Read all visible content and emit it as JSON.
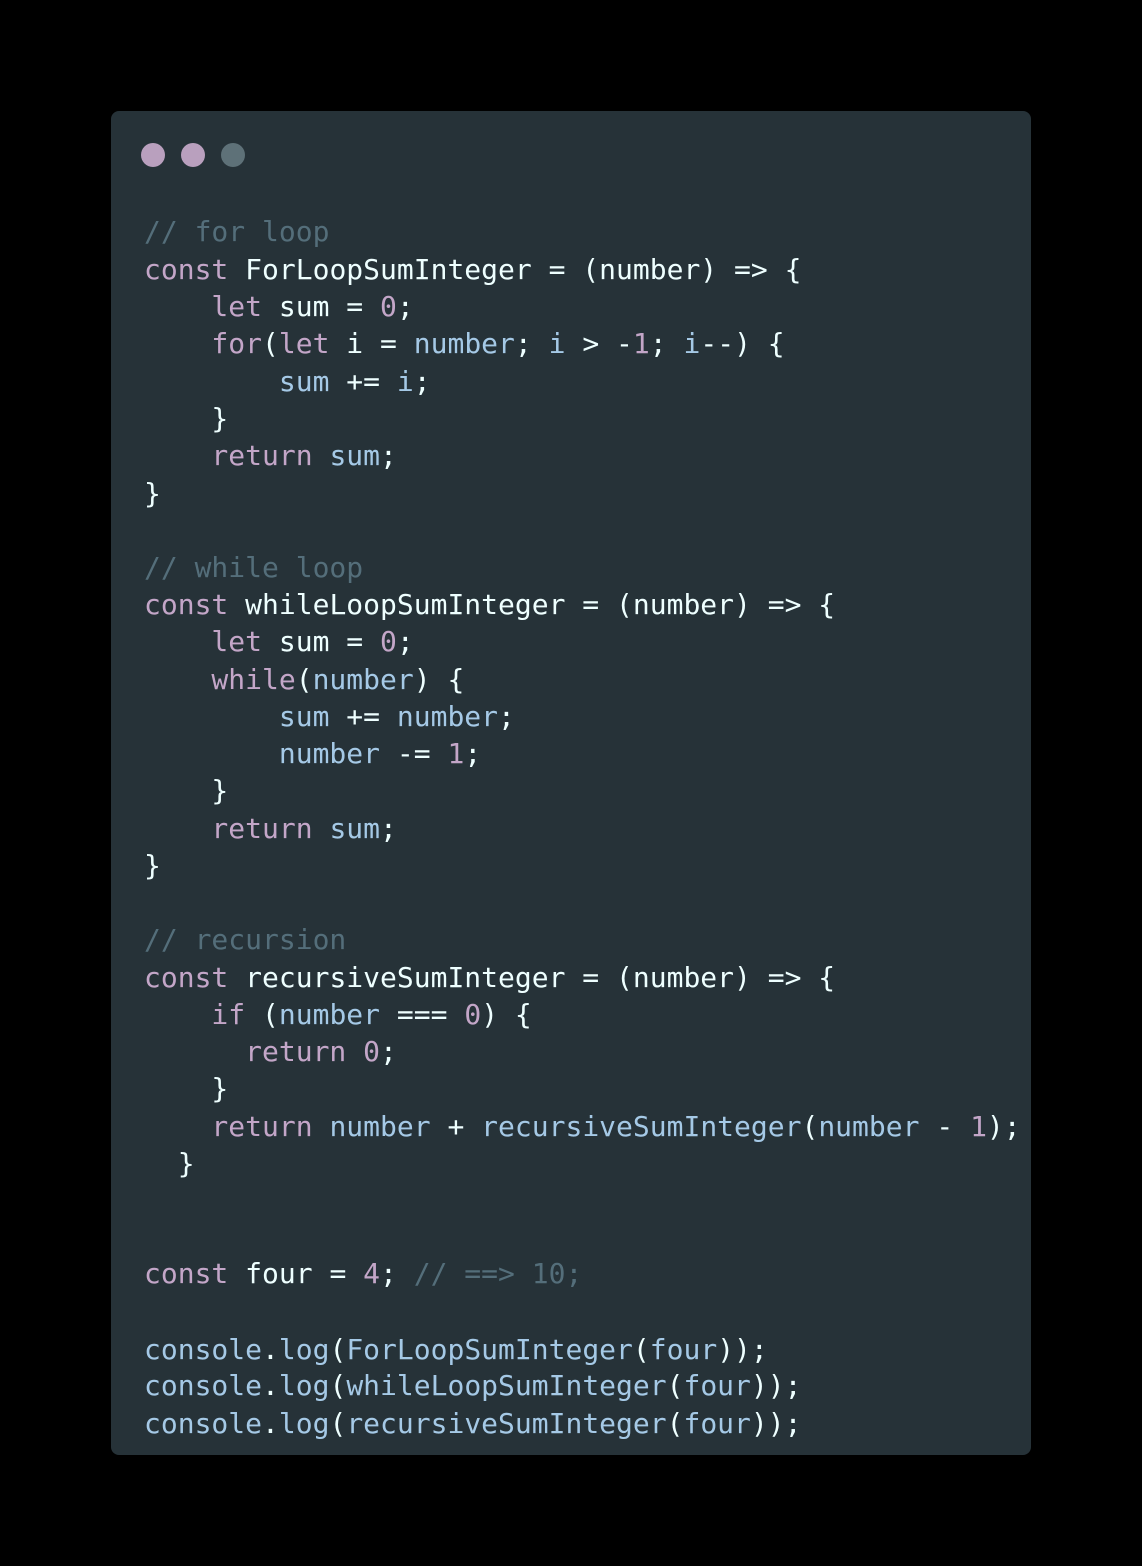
{
  "window": {
    "controls": [
      {
        "name": "close",
        "color": "#b9a0be"
      },
      {
        "name": "minimize",
        "color": "#b9a0be"
      },
      {
        "name": "maximize",
        "color": "#5e7178"
      }
    ]
  },
  "colors": {
    "background": "#000000",
    "editor_background": "#263238",
    "comment": "#546e7a",
    "keyword": "#c3a6c8",
    "identifier": "#a5c9e6",
    "text": "#eeffff"
  },
  "code": {
    "language": "javascript",
    "lines": [
      [
        {
          "t": "// for loop",
          "c": "comment"
        }
      ],
      [
        {
          "t": "const",
          "c": "keyword"
        },
        {
          "t": " ForLoopSumInteger = (number) => {",
          "c": "plain"
        }
      ],
      [
        {
          "t": "    let",
          "c": "keyword"
        },
        {
          "t": " sum = ",
          "c": "plain"
        },
        {
          "t": "0",
          "c": "num"
        },
        {
          "t": ";",
          "c": "plain"
        }
      ],
      [
        {
          "t": "    for",
          "c": "keyword"
        },
        {
          "t": "(",
          "c": "plain"
        },
        {
          "t": "let",
          "c": "keyword"
        },
        {
          "t": " i = ",
          "c": "plain"
        },
        {
          "t": "number",
          "c": "var"
        },
        {
          "t": "; ",
          "c": "plain"
        },
        {
          "t": "i",
          "c": "var"
        },
        {
          "t": " > -",
          "c": "plain"
        },
        {
          "t": "1",
          "c": "num"
        },
        {
          "t": "; ",
          "c": "plain"
        },
        {
          "t": "i",
          "c": "var"
        },
        {
          "t": "--) {",
          "c": "plain"
        }
      ],
      [
        {
          "t": "        sum",
          "c": "var"
        },
        {
          "t": " += ",
          "c": "plain"
        },
        {
          "t": "i",
          "c": "var"
        },
        {
          "t": ";",
          "c": "plain"
        }
      ],
      [
        {
          "t": "    }",
          "c": "plain"
        }
      ],
      [
        {
          "t": "    return",
          "c": "keyword"
        },
        {
          "t": " ",
          "c": "plain"
        },
        {
          "t": "sum",
          "c": "var"
        },
        {
          "t": ";",
          "c": "plain"
        }
      ],
      [
        {
          "t": "}",
          "c": "plain"
        }
      ],
      [
        {
          "t": "",
          "c": "plain"
        }
      ],
      [
        {
          "t": "// while loop",
          "c": "comment"
        }
      ],
      [
        {
          "t": "const",
          "c": "keyword"
        },
        {
          "t": " whileLoopSumInteger = (number) => {",
          "c": "plain"
        }
      ],
      [
        {
          "t": "    let",
          "c": "keyword"
        },
        {
          "t": " sum = ",
          "c": "plain"
        },
        {
          "t": "0",
          "c": "num"
        },
        {
          "t": ";",
          "c": "plain"
        }
      ],
      [
        {
          "t": "    while",
          "c": "keyword"
        },
        {
          "t": "(",
          "c": "plain"
        },
        {
          "t": "number",
          "c": "var"
        },
        {
          "t": ") {",
          "c": "plain"
        }
      ],
      [
        {
          "t": "        sum",
          "c": "var"
        },
        {
          "t": " += ",
          "c": "plain"
        },
        {
          "t": "number",
          "c": "var"
        },
        {
          "t": ";",
          "c": "plain"
        }
      ],
      [
        {
          "t": "        number",
          "c": "var"
        },
        {
          "t": " -= ",
          "c": "plain"
        },
        {
          "t": "1",
          "c": "num"
        },
        {
          "t": ";",
          "c": "plain"
        }
      ],
      [
        {
          "t": "    }",
          "c": "plain"
        }
      ],
      [
        {
          "t": "    return",
          "c": "keyword"
        },
        {
          "t": " ",
          "c": "plain"
        },
        {
          "t": "sum",
          "c": "var"
        },
        {
          "t": ";",
          "c": "plain"
        }
      ],
      [
        {
          "t": "}",
          "c": "plain"
        }
      ],
      [
        {
          "t": "",
          "c": "plain"
        }
      ],
      [
        {
          "t": "// recursion",
          "c": "comment"
        }
      ],
      [
        {
          "t": "const",
          "c": "keyword"
        },
        {
          "t": " recursiveSumInteger = (number) => {",
          "c": "plain"
        }
      ],
      [
        {
          "t": "    if",
          "c": "keyword"
        },
        {
          "t": " (",
          "c": "plain"
        },
        {
          "t": "number",
          "c": "var"
        },
        {
          "t": " === ",
          "c": "plain"
        },
        {
          "t": "0",
          "c": "num"
        },
        {
          "t": ") {",
          "c": "plain"
        }
      ],
      [
        {
          "t": "      return",
          "c": "keyword"
        },
        {
          "t": " ",
          "c": "plain"
        },
        {
          "t": "0",
          "c": "num"
        },
        {
          "t": ";",
          "c": "plain"
        }
      ],
      [
        {
          "t": "    }",
          "c": "plain"
        }
      ],
      [
        {
          "t": "    return",
          "c": "keyword"
        },
        {
          "t": " ",
          "c": "plain"
        },
        {
          "t": "number",
          "c": "var"
        },
        {
          "t": " + ",
          "c": "plain"
        },
        {
          "t": "recursiveSumInteger",
          "c": "var"
        },
        {
          "t": "(",
          "c": "plain"
        },
        {
          "t": "number",
          "c": "var"
        },
        {
          "t": " - ",
          "c": "plain"
        },
        {
          "t": "1",
          "c": "num"
        },
        {
          "t": ");",
          "c": "plain"
        }
      ],
      [
        {
          "t": "  }",
          "c": "plain"
        }
      ],
      [
        {
          "t": "",
          "c": "plain"
        }
      ],
      [
        {
          "t": "",
          "c": "plain"
        }
      ],
      [
        {
          "t": "const",
          "c": "keyword"
        },
        {
          "t": " four = ",
          "c": "plain"
        },
        {
          "t": "4",
          "c": "num"
        },
        {
          "t": "; ",
          "c": "plain"
        },
        {
          "t": "// ==> 10;",
          "c": "comment"
        }
      ],
      [
        {
          "t": "",
          "c": "plain"
        }
      ],
      [
        {
          "t": "console",
          "c": "var"
        },
        {
          "t": ".",
          "c": "plain"
        },
        {
          "t": "log",
          "c": "var"
        },
        {
          "t": "(",
          "c": "plain"
        },
        {
          "t": "ForLoopSumInteger",
          "c": "var"
        },
        {
          "t": "(",
          "c": "plain"
        },
        {
          "t": "four",
          "c": "var"
        },
        {
          "t": "));",
          "c": "plain"
        }
      ],
      [
        {
          "t": "console",
          "c": "var"
        },
        {
          "t": ".",
          "c": "plain"
        },
        {
          "t": "log",
          "c": "var"
        },
        {
          "t": "(",
          "c": "plain"
        },
        {
          "t": "whileLoopSumInteger",
          "c": "var"
        },
        {
          "t": "(",
          "c": "plain"
        },
        {
          "t": "four",
          "c": "var"
        },
        {
          "t": "));",
          "c": "plain"
        }
      ],
      [
        {
          "t": "console",
          "c": "var"
        },
        {
          "t": ".",
          "c": "plain"
        },
        {
          "t": "log",
          "c": "var"
        },
        {
          "t": "(",
          "c": "plain"
        },
        {
          "t": "recursiveSumInteger",
          "c": "var"
        },
        {
          "t": "(",
          "c": "plain"
        },
        {
          "t": "four",
          "c": "var"
        },
        {
          "t": "));",
          "c": "plain"
        }
      ]
    ]
  }
}
